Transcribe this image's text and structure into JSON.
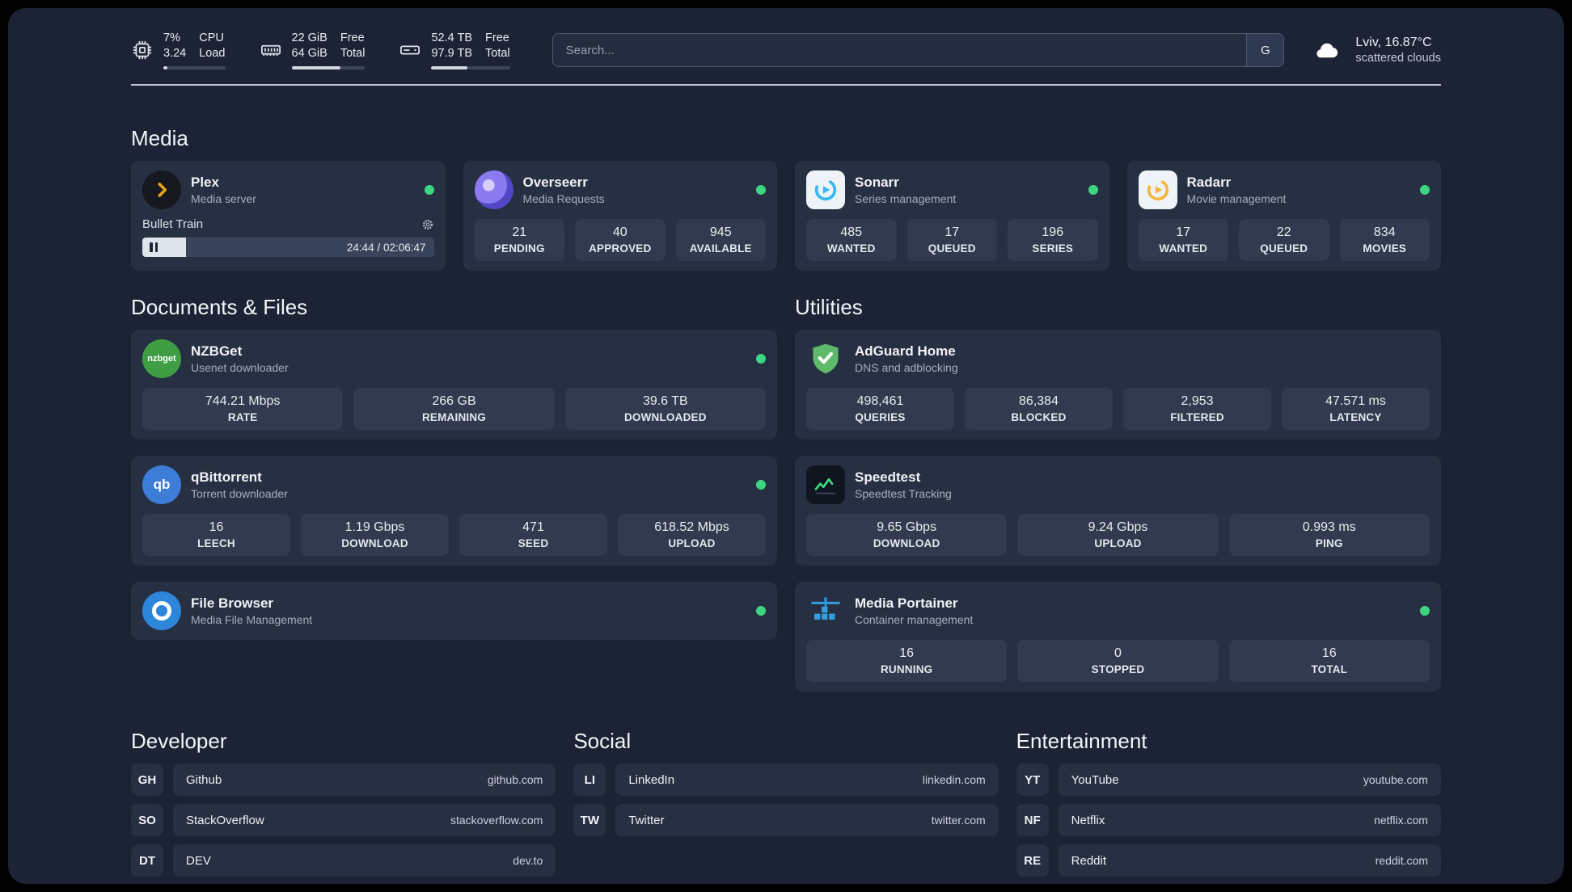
{
  "topbar": {
    "cpu": {
      "value": "7%",
      "load": "3.24",
      "label_top": "CPU",
      "label_bottom": "Load",
      "progress": 7
    },
    "ram": {
      "free": "22 GiB",
      "total": "64 GiB",
      "label_top": "Free",
      "label_bottom": "Total",
      "progress": 66
    },
    "storage": {
      "free": "52.4 TB",
      "total": "97.9 TB",
      "label_top": "Free",
      "label_bottom": "Total",
      "progress": 46
    },
    "search": {
      "placeholder": "Search...",
      "provider": "G"
    },
    "weather": {
      "location": "Lviv, 16.87°C",
      "condition": "scattered clouds"
    }
  },
  "sections": {
    "media": {
      "title": "Media",
      "plex": {
        "name": "Plex",
        "subtitle": "Media server",
        "player_title": "Bullet Train",
        "player_time": "24:44 / 02:06:47",
        "player_progress": 15
      },
      "overseerr": {
        "name": "Overseerr",
        "subtitle": "Media Requests",
        "stats": [
          {
            "value": "21",
            "label": "PENDING"
          },
          {
            "value": "40",
            "label": "APPROVED"
          },
          {
            "value": "945",
            "label": "AVAILABLE"
          }
        ]
      },
      "sonarr": {
        "name": "Sonarr",
        "subtitle": "Series management",
        "stats": [
          {
            "value": "485",
            "label": "WANTED"
          },
          {
            "value": "17",
            "label": "QUEUED"
          },
          {
            "value": "196",
            "label": "SERIES"
          }
        ]
      },
      "radarr": {
        "name": "Radarr",
        "subtitle": "Movie management",
        "stats": [
          {
            "value": "17",
            "label": "WANTED"
          },
          {
            "value": "22",
            "label": "QUEUED"
          },
          {
            "value": "834",
            "label": "MOVIES"
          }
        ]
      }
    },
    "documents": {
      "title": "Documents & Files",
      "nzbget": {
        "name": "NZBGet",
        "subtitle": "Usenet downloader",
        "icon_text": "nzbget",
        "stats": [
          {
            "value": "744.21 Mbps",
            "label": "RATE"
          },
          {
            "value": "266 GB",
            "label": "REMAINING"
          },
          {
            "value": "39.6 TB",
            "label": "DOWNLOADED"
          }
        ]
      },
      "qbittorrent": {
        "name": "qBittorrent",
        "subtitle": "Torrent downloader",
        "icon_text": "qb",
        "stats": [
          {
            "value": "16",
            "label": "LEECH"
          },
          {
            "value": "1.19 Gbps",
            "label": "DOWNLOAD"
          },
          {
            "value": "471",
            "label": "SEED"
          },
          {
            "value": "618.52 Mbps",
            "label": "UPLOAD"
          }
        ]
      },
      "filebrowser": {
        "name": "File Browser",
        "subtitle": "Media File Management"
      }
    },
    "utilities": {
      "title": "Utilities",
      "adguard": {
        "name": "AdGuard Home",
        "subtitle": "DNS and adblocking",
        "stats": [
          {
            "value": "498,461",
            "label": "QUERIES"
          },
          {
            "value": "86,384",
            "label": "BLOCKED"
          },
          {
            "value": "2,953",
            "label": "FILTERED"
          },
          {
            "value": "47.571 ms",
            "label": "LATENCY"
          }
        ]
      },
      "speedtest": {
        "name": "Speedtest",
        "subtitle": "Speedtest Tracking",
        "stats": [
          {
            "value": "9.65 Gbps",
            "label": "DOWNLOAD"
          },
          {
            "value": "9.24 Gbps",
            "label": "UPLOAD"
          },
          {
            "value": "0.993 ms",
            "label": "PING"
          }
        ]
      },
      "portainer": {
        "name": "Media Portainer",
        "subtitle": "Container management",
        "stats": [
          {
            "value": "16",
            "label": "RUNNING"
          },
          {
            "value": "0",
            "label": "STOPPED"
          },
          {
            "value": "16",
            "label": "TOTAL"
          }
        ]
      }
    }
  },
  "bookmarks": [
    {
      "title": "Developer",
      "items": [
        {
          "abbr": "GH",
          "name": "Github",
          "url": "github.com"
        },
        {
          "abbr": "SO",
          "name": "StackOverflow",
          "url": "stackoverflow.com"
        },
        {
          "abbr": "DT",
          "name": "DEV",
          "url": "dev.to"
        }
      ]
    },
    {
      "title": "Social",
      "items": [
        {
          "abbr": "LI",
          "name": "LinkedIn",
          "url": "linkedin.com"
        },
        {
          "abbr": "TW",
          "name": "Twitter",
          "url": "twitter.com"
        }
      ]
    },
    {
      "title": "Entertainment",
      "items": [
        {
          "abbr": "YT",
          "name": "YouTube",
          "url": "youtube.com"
        },
        {
          "abbr": "NF",
          "name": "Netflix",
          "url": "netflix.com"
        },
        {
          "abbr": "RE",
          "name": "Reddit",
          "url": "reddit.com"
        }
      ]
    }
  ]
}
